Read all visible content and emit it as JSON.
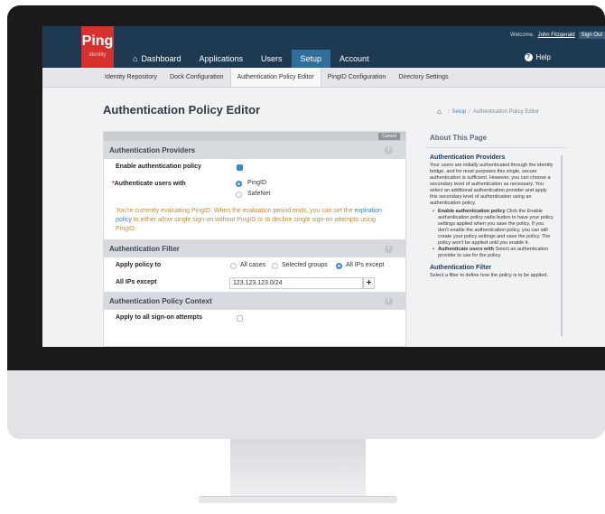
{
  "app": {
    "logo_word": "Ping",
    "logo_sub": "identity",
    "welcome_text": "Welcome,",
    "user_name": "John Fitzgerald",
    "sign_out": "Sign Out",
    "help_label": "Help"
  },
  "nav": {
    "items": [
      {
        "label": "Dashboard",
        "icon": "home-icon"
      },
      {
        "label": "Applications"
      },
      {
        "label": "Users"
      },
      {
        "label": "Setup",
        "active": true
      },
      {
        "label": "Account"
      }
    ]
  },
  "subnav": {
    "items": [
      {
        "label": "Identity Repository"
      },
      {
        "label": "Dock Configuration"
      },
      {
        "label": "Authentication Policy Editor",
        "active": true
      },
      {
        "label": "PingID Configuration"
      },
      {
        "label": "Directory Settings"
      }
    ]
  },
  "page": {
    "title": "Authentication Policy Editor",
    "breadcrumb": [
      "Setup",
      "Authentication Policy Editor"
    ]
  },
  "form": {
    "cancel_label": "Cancel",
    "sections": {
      "providers": "Authentication Providers",
      "filter": "Authentication Filter",
      "context": "Authentication Policy Context"
    },
    "enable_policy": {
      "label": "Enable authentication policy",
      "checked": true
    },
    "authenticate_with": {
      "label": "Authenticate users with",
      "required_mark": "*",
      "options": [
        "PingID",
        "SafeNet"
      ],
      "selected": "PingID"
    },
    "warning": {
      "before": "You're currently evaluating PingID. When the evaluation period ends, you can set the",
      "link": "expiration policy",
      "after": "to either allow single sign-on without PingID or to decline single sign-on attempts using PingID."
    },
    "apply_policy": {
      "label": "Apply policy to",
      "options": [
        "All cases",
        "Selected groups",
        "All IPs except"
      ],
      "selected": "All IPs except"
    },
    "ips_except": {
      "label": "All IPs except",
      "value": "123.123.123.0/24",
      "add": "+"
    },
    "apply_all": {
      "label": "Apply to all sign-on attempts",
      "checked": false
    }
  },
  "help_panel": {
    "heading": "About This Page",
    "providers_title": "Authentication Providers",
    "providers_text": "Your users are initially authenticated through the identity bridge, and for most purposes this single, secure authentication is sufficient. However, you can choose a secondary level of authentication as necessary. You select an additional authentication provider and apply this secondary level of authentication using an authentication policy.",
    "bullets": [
      {
        "bold": "Enable authentication policy",
        "text": "Click the Enable authentication policy radio button to have your policy settings applied when you save the policy. If you don't enable the authentication policy, you can still create your policy settings and save the policy. The policy won't be applied until you enable it."
      },
      {
        "bold": "Authenticate users with",
        "text": "Select an authentication provider to use for the policy."
      }
    ],
    "filter_title": "Authentication Filter",
    "filter_text": "Select a filter to define how the policy is to be applied."
  },
  "colors": {
    "topbar": "#1e3a53",
    "brand_red": "#d7312f",
    "accent_blue": "#3a87c8",
    "warning_text": "#c48a35"
  }
}
